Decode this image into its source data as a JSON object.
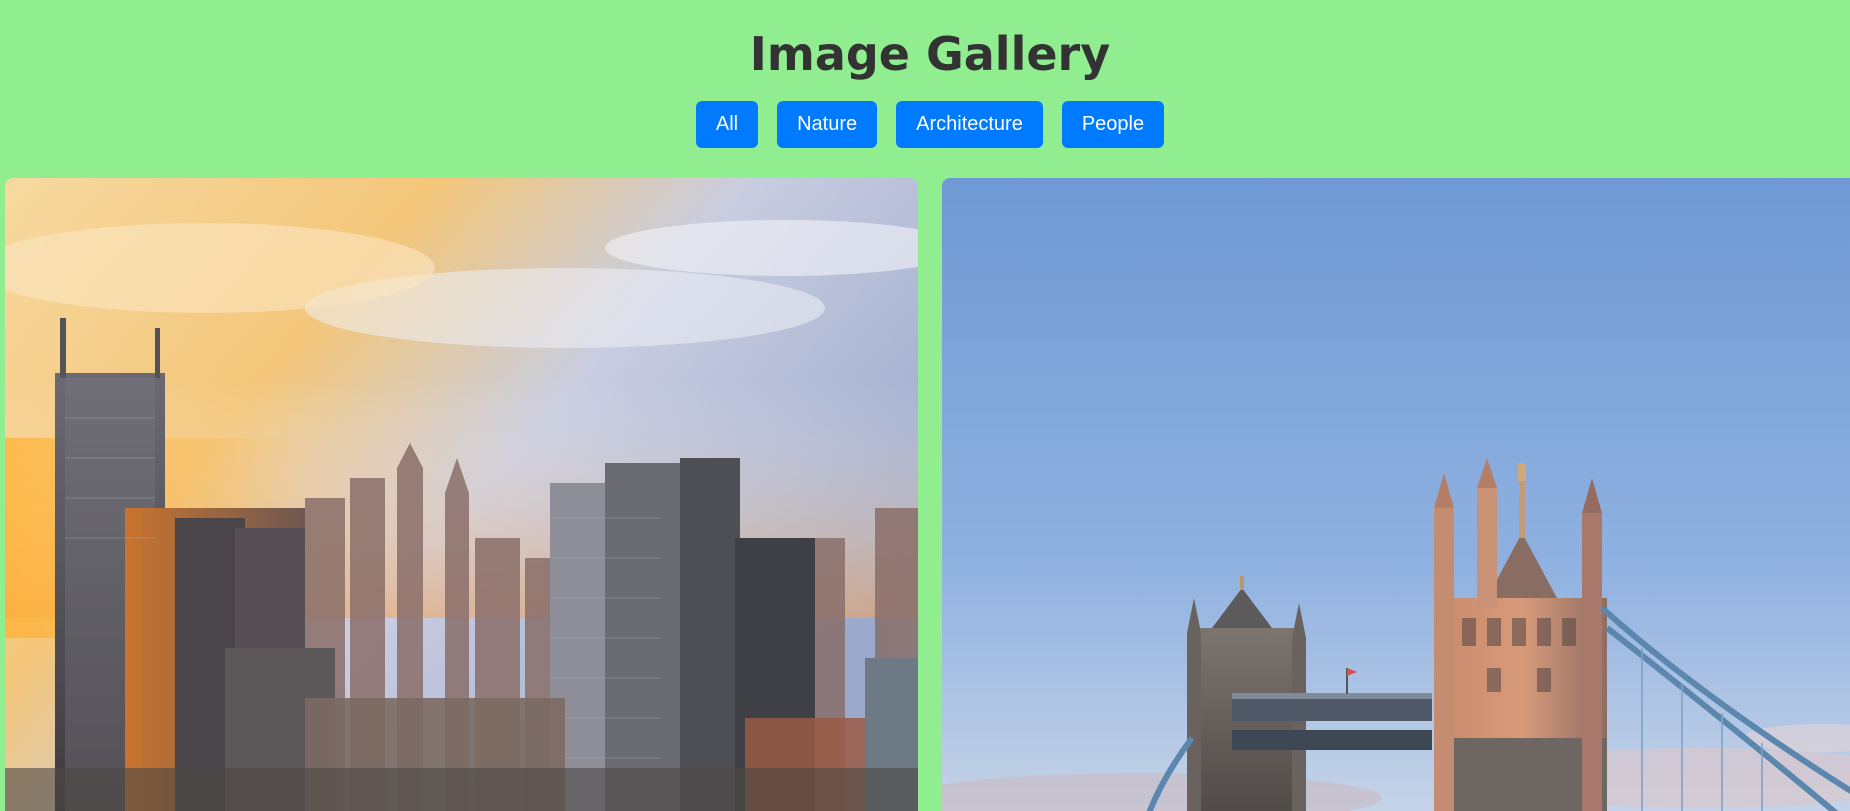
{
  "header": {
    "title": "Image Gallery"
  },
  "filters": [
    {
      "label": "All"
    },
    {
      "label": "Nature"
    },
    {
      "label": "Architecture"
    },
    {
      "label": "People"
    }
  ],
  "gallery": {
    "images": [
      {
        "subject": "city skyline at sunset"
      },
      {
        "subject": "tower bridge with blue sky"
      }
    ]
  },
  "colors": {
    "background": "#90ee90",
    "button": "#007bff",
    "button_text": "#ffffff",
    "title": "#333333"
  }
}
